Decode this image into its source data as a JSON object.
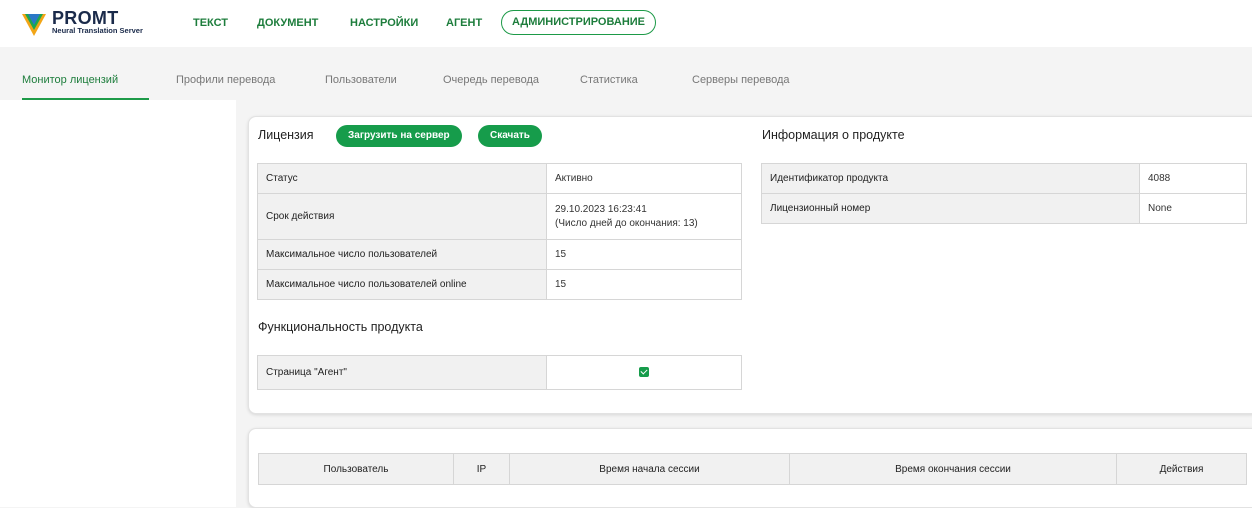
{
  "brand": {
    "title": "PROMT",
    "subtitle": "Neural Translation Server",
    "colors": {
      "accent": "#169c4b",
      "text_accent": "#1d7d3c",
      "logo_blue": "#1a2a4a"
    }
  },
  "topnav": {
    "items": [
      {
        "label": "ТЕКСТ"
      },
      {
        "label": "ДОКУМЕНТ"
      },
      {
        "label": "НАСТРОЙКИ"
      },
      {
        "label": "АГЕНТ"
      },
      {
        "label": "АДМИНИСТРИРОВАНИЕ",
        "active": true
      }
    ]
  },
  "subnav": {
    "tabs": [
      {
        "label": "Монитор лицензий",
        "active": true
      },
      {
        "label": "Профили перевода"
      },
      {
        "label": "Пользователи"
      },
      {
        "label": "Очередь перевода"
      },
      {
        "label": "Статистика"
      },
      {
        "label": "Серверы перевода"
      }
    ]
  },
  "license": {
    "title": "Лицензия",
    "upload_button": "Загрузить на сервер",
    "download_button": "Скачать",
    "rows": [
      {
        "key": "Статус",
        "value": "Активно"
      },
      {
        "key": "Срок действия",
        "value": "29.10.2023 16:23:41",
        "value2": "(Число дней до окончания: 13)"
      },
      {
        "key": "Максимальное число пользователей",
        "value": "15"
      },
      {
        "key": "Максимальное число пользователей online",
        "value": "15"
      }
    ]
  },
  "functionality": {
    "title": "Функциональность продукта",
    "rows": [
      {
        "key": "Страница \"Агент\"",
        "checked": true
      }
    ]
  },
  "product_info": {
    "title": "Информация о продукте",
    "rows": [
      {
        "key": "Идентификатор продукта",
        "value": "4088"
      },
      {
        "key": "Лицензионный номер",
        "value": "None"
      }
    ]
  },
  "sessions": {
    "columns": [
      "Пользователь",
      "IP",
      "Время начала сессии",
      "Время окончания сессии",
      "Действия"
    ]
  }
}
